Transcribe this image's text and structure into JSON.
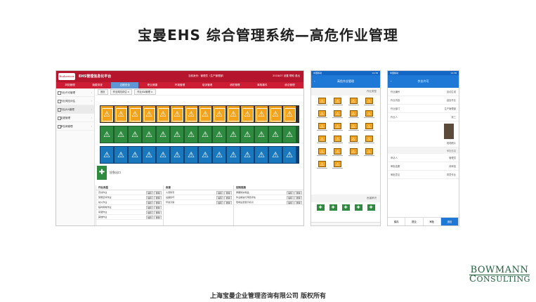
{
  "slide": {
    "title": "宝曼EHS 综合管理系统—高危作业管理",
    "footer": "上海宝曼企业管理咨询有限公司 版权所有",
    "logo": {
      "line1": "BOWMANN",
      "line2_big": "C",
      "line2": "ONSULTING"
    }
  },
  "desktop": {
    "brand": "Budweiser",
    "app_title": "EHS管理信息化平台",
    "user": "当前身份：管理员（生产管理部）",
    "top_icons": "2018/07   设置   帮助   退出",
    "nav": [
      "风险管理",
      "隐患排查",
      "过程安全",
      "职业健康",
      "环境管理",
      "培训管理",
      "消防管理",
      "事故事件",
      "综合管理"
    ],
    "nav_active": 2,
    "sidebar": [
      "作业许可管理",
      "作业风险评估",
      "作业JSA管理",
      "变更管理",
      "承包商管理"
    ],
    "sidebar_active": 2,
    "crumbs": [
      "首页",
      "作业风险评估 ×",
      "作业JSA管理 ×"
    ],
    "icon_rows": {
      "r1": [
        "⚠",
        "⚠",
        "⚠",
        "⚠",
        "⚠",
        "⚠",
        "⚠",
        "⚠",
        "⚠",
        "⚠",
        "⚠",
        "⚠",
        "⚠",
        "⚠"
      ],
      "r2": [
        "⚠",
        "⚠",
        "⚠",
        "⚠",
        "⚠",
        "⚠",
        "⚠",
        "⚠",
        "⚠",
        "⚠",
        "⚠",
        "⚠",
        "⚠",
        "⚠"
      ],
      "r3": [
        "⚠",
        "⚠",
        "⚠",
        "⚠",
        "⚠",
        "⚠",
        "⚠",
        "⚠",
        "⚠",
        "⚠",
        "⚠",
        "⚠",
        "⚠",
        "⚠"
      ]
    },
    "selected_label": "应急出口",
    "tables": [
      {
        "title": "作业类型",
        "rows": [
          "高处作业",
          "受限空间作业",
          "动火作业",
          "临时用电作业",
          "吊装作业",
          "其他作业"
        ]
      },
      {
        "title": "危害",
        "rows": [
          "人员伤害",
          "设备损坏",
          "环境污染"
        ]
      },
      {
        "title": "控制措施",
        "rows": [
          "佩戴防护用品",
          "作业前进行风险评估",
          "现场设置警示标识"
        ]
      }
    ],
    "row_btn_edit": "编辑",
    "row_btn_delete": "删除"
  },
  "phone1": {
    "status_left": "中国移动",
    "status_right": "14:38",
    "header": "高危作业管理",
    "section1": "作业类型",
    "section2": "危害辨识",
    "glyph_warn": "⚠",
    "glyph_safe": "✚"
  },
  "phone2": {
    "status_left": "中国移动",
    "status_right": "14:38",
    "header": "作业许可",
    "fields": [
      {
        "label": "作业编号",
        "value": "自动生成"
      },
      {
        "label": "作业内容",
        "value": "高处作业"
      },
      {
        "label": "作业部门",
        "value": "生产管理部"
      },
      {
        "label": "作业人",
        "value": "张三"
      }
    ],
    "photo_caption": "现场照片",
    "section": "审批信息",
    "fields2": [
      {
        "label": "申请人",
        "value": "管理员"
      },
      {
        "label": "审批结果",
        "value": "待审批"
      },
      {
        "label": "审批意见",
        "value": "同意作业"
      }
    ],
    "actions": [
      "保存",
      "提交",
      "审批",
      "退回"
    ]
  }
}
